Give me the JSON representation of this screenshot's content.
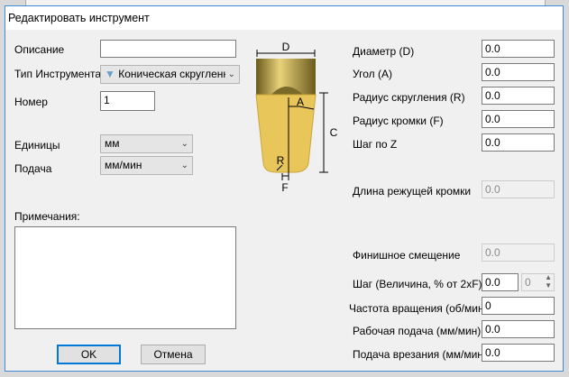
{
  "title": "Редактировать инструмент",
  "left": {
    "description_label": "Описание",
    "description_value": "",
    "tool_type_label": "Тип Инструмента",
    "tool_type_value": "Коническая скругленн",
    "number_label": "Номер",
    "number_value": "1",
    "units_label": "Единицы",
    "units_value": "мм",
    "feed_label": "Подача",
    "feed_value": "мм/мин",
    "notes_label": "Примечания:",
    "notes_value": ""
  },
  "diagram": {
    "d": "D",
    "a": "A",
    "c": "C",
    "r": "R",
    "f": "F"
  },
  "right": {
    "diameter_label": "Диаметр (D)",
    "diameter_value": "0.0",
    "angle_label": "Угол (A)",
    "angle_value": "0.0",
    "fillet_label": "Радиус скругления (R)",
    "fillet_value": "0.0",
    "edge_label": "Радиус кромки (F)",
    "edge_value": "0.0",
    "zstep_label": "Шаг по Z",
    "zstep_value": "0.0",
    "cut_length_label": "Длина режущей кромки",
    "cut_length_value": "0.0",
    "finish_label": "Финишное смещение",
    "finish_value": "0.0",
    "step_label": "Шаг (Величина, % от 2xF)",
    "step_value": "0.0",
    "step_percent": "0",
    "spindle_label": "Частота вращения (об/мин)",
    "spindle_value": "0",
    "work_feed_label": "Рабочая подача (мм/мин)",
    "work_feed_value": "0.0",
    "plunge_label": "Подача врезания (мм/мин)",
    "plunge_value": "0.0"
  },
  "buttons": {
    "ok": "OK",
    "cancel": "Отмена"
  },
  "colors": {
    "border": "#3c8ad8",
    "tool_gold": "#e8c65a"
  }
}
